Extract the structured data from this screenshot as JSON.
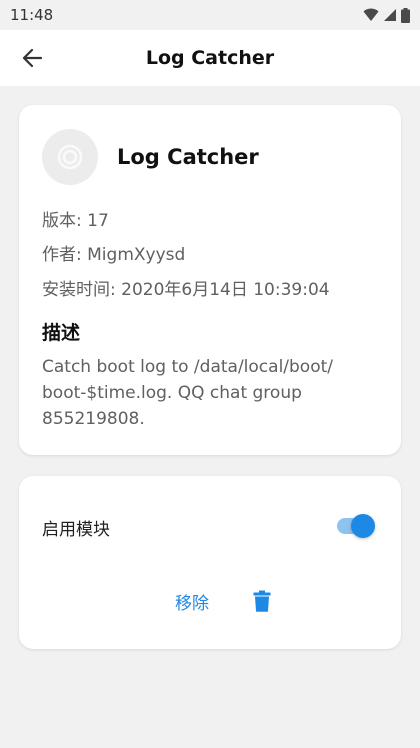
{
  "status_bar": {
    "time": "11:48",
    "icons": [
      "wifi-icon",
      "cell-signal-icon",
      "battery-icon"
    ]
  },
  "app_bar": {
    "title": "Log Catcher",
    "back_icon": "arrow-left-icon"
  },
  "module": {
    "name": "Log Catcher",
    "icon": "module-ring-icon",
    "version": "版本: 17",
    "author": "作者: MigmXyysd",
    "installed": "安装时间: 2020年6月14日 10:39:04",
    "description_heading": "描述",
    "description": "Catch boot log to /data/local/boot/ boot-$time.log. QQ chat group 855219808."
  },
  "controls": {
    "enable_label": "启用模块",
    "enabled": true,
    "remove_label": "移除",
    "remove_icon": "trash-icon"
  },
  "colors": {
    "accent": "#1e88e5",
    "background": "#f1f1f1",
    "card": "#ffffff"
  }
}
